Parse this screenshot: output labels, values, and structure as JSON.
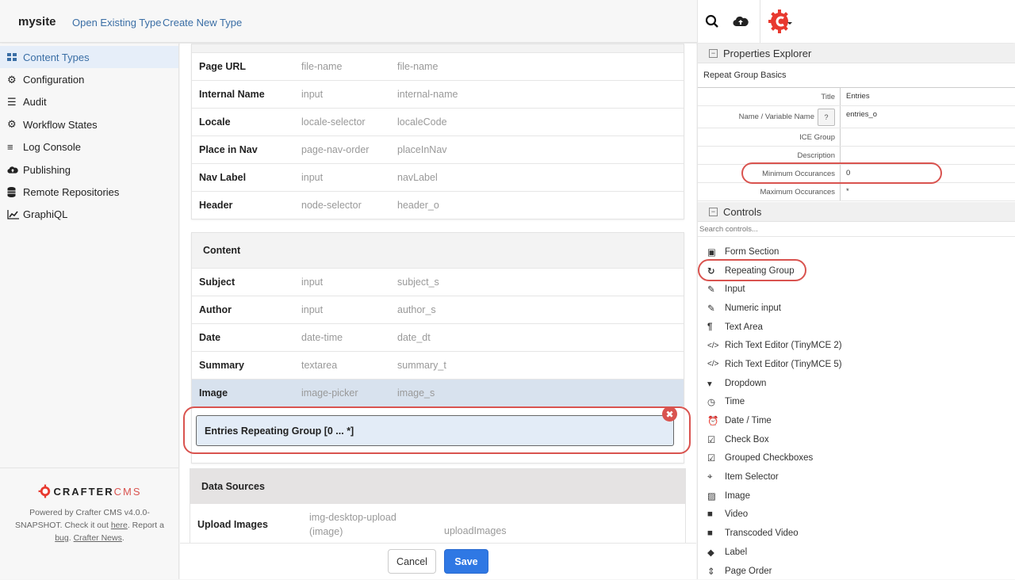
{
  "header": {
    "site": "mysite",
    "links": [
      "Open Existing Type",
      "Create New Type"
    ],
    "icons": [
      "search-icon",
      "publish-cloud-icon",
      "crafter-logo-menu-icon"
    ]
  },
  "sidebar": {
    "items": [
      {
        "label": "Content Types",
        "icon": "grid-icon",
        "active": true
      },
      {
        "label": "Configuration",
        "icon": "gear-icon"
      },
      {
        "label": "Audit",
        "icon": "list-icon"
      },
      {
        "label": "Workflow States",
        "icon": "gear-icon"
      },
      {
        "label": "Log Console",
        "icon": "lines-icon"
      },
      {
        "label": "Publishing",
        "icon": "cloud-upload-icon"
      },
      {
        "label": "Remote Repositories",
        "icon": "database-icon"
      },
      {
        "label": "GraphiQL",
        "icon": "chart-line-icon"
      }
    ],
    "footer": {
      "logo_main": "CRAFTER",
      "logo_cms": "CMS",
      "powered_prefix": "Powered by Crafter CMS v4.0.0-SNAPSHOT. Check it out ",
      "here": "here",
      "report": ". Report a ",
      "bug": "bug",
      "sep": ". ",
      "news": "Crafter News",
      "end": "."
    }
  },
  "main": {
    "section1_rows": [
      {
        "name": "Page URL",
        "type": "file-name",
        "id": "file-name"
      },
      {
        "name": "Internal Name",
        "type": "input",
        "id": "internal-name"
      },
      {
        "name": "Locale",
        "type": "locale-selector",
        "id": "localeCode"
      },
      {
        "name": "Place in Nav",
        "type": "page-nav-order",
        "id": "placeInNav"
      },
      {
        "name": "Nav Label",
        "type": "input",
        "id": "navLabel"
      },
      {
        "name": "Header",
        "type": "node-selector",
        "id": "header_o"
      }
    ],
    "content": {
      "title": "Content",
      "rows": [
        {
          "name": "Subject",
          "type": "input",
          "id": "subject_s"
        },
        {
          "name": "Author",
          "type": "input",
          "id": "author_s"
        },
        {
          "name": "Date",
          "type": "date-time",
          "id": "date_dt"
        },
        {
          "name": "Summary",
          "type": "textarea",
          "id": "summary_t"
        },
        {
          "name": "Image",
          "type": "image-picker",
          "id": "image_s"
        }
      ],
      "repeating_group": "Entries Repeating Group [0 ... *]",
      "remove_glyph": "✖"
    },
    "data_sources": {
      "title": "Data Sources",
      "rows": [
        {
          "name": "Upload Images",
          "type_line1": "img-desktop-upload",
          "type_line2": "(image)",
          "id": "uploadImages"
        }
      ]
    },
    "actions": {
      "cancel": "Cancel",
      "save": "Save"
    }
  },
  "properties": {
    "title": "Properties Explorer",
    "collapse_glyph": "−",
    "group": "Repeat Group Basics",
    "rows": [
      {
        "key": "Title",
        "value": "Entries"
      },
      {
        "key": "Name / Variable Name",
        "value": "entries_o"
      },
      {
        "key": "ICE Group",
        "value": ""
      },
      {
        "key": "Description",
        "value": ""
      },
      {
        "key": "Minimum Occurances",
        "value": "0"
      },
      {
        "key": "Maximum Occurances",
        "value": "*"
      }
    ],
    "help_glyph": "?"
  },
  "controls": {
    "title": "Controls",
    "search_placeholder": "Search controls...",
    "items": [
      {
        "label": "Form Section",
        "icon": "form-section-icon",
        "glyph": "▣"
      },
      {
        "label": "Repeating Group",
        "icon": "repeat-icon",
        "glyph": "↻"
      },
      {
        "label": "Input",
        "icon": "edit-icon",
        "glyph": "✎"
      },
      {
        "label": "Numeric input",
        "icon": "pencil-square-icon",
        "glyph": "✎"
      },
      {
        "label": "Text Area",
        "icon": "paragraph-icon",
        "glyph": "¶"
      },
      {
        "label": "Rich Text Editor (TinyMCE 2)",
        "icon": "code-icon",
        "glyph": "</>"
      },
      {
        "label": "Rich Text Editor (TinyMCE 5)",
        "icon": "code-icon",
        "glyph": "</>"
      },
      {
        "label": "Dropdown",
        "icon": "caret-down-icon",
        "glyph": "▾"
      },
      {
        "label": "Time",
        "icon": "clock-icon",
        "glyph": "◷"
      },
      {
        "label": "Date / Time",
        "icon": "calendar-clock-icon",
        "glyph": "⏰"
      },
      {
        "label": "Check Box",
        "icon": "checkbox-icon",
        "glyph": "☑"
      },
      {
        "label": "Grouped Checkboxes",
        "icon": "checkbox-icon",
        "glyph": "☑"
      },
      {
        "label": "Item Selector",
        "icon": "crosshairs-icon",
        "glyph": "⌖"
      },
      {
        "label": "Image",
        "icon": "image-icon",
        "glyph": "▨"
      },
      {
        "label": "Video",
        "icon": "video-icon",
        "glyph": "■"
      },
      {
        "label": "Transcoded Video",
        "icon": "video-icon",
        "glyph": "■"
      },
      {
        "label": "Label",
        "icon": "tag-icon",
        "glyph": "◆"
      },
      {
        "label": "Page Order",
        "icon": "sort-icon",
        "glyph": "⇕"
      }
    ]
  },
  "colors": {
    "accent": "#2f78e4",
    "link": "#3a6ea5",
    "highlight": "#d9534f"
  }
}
